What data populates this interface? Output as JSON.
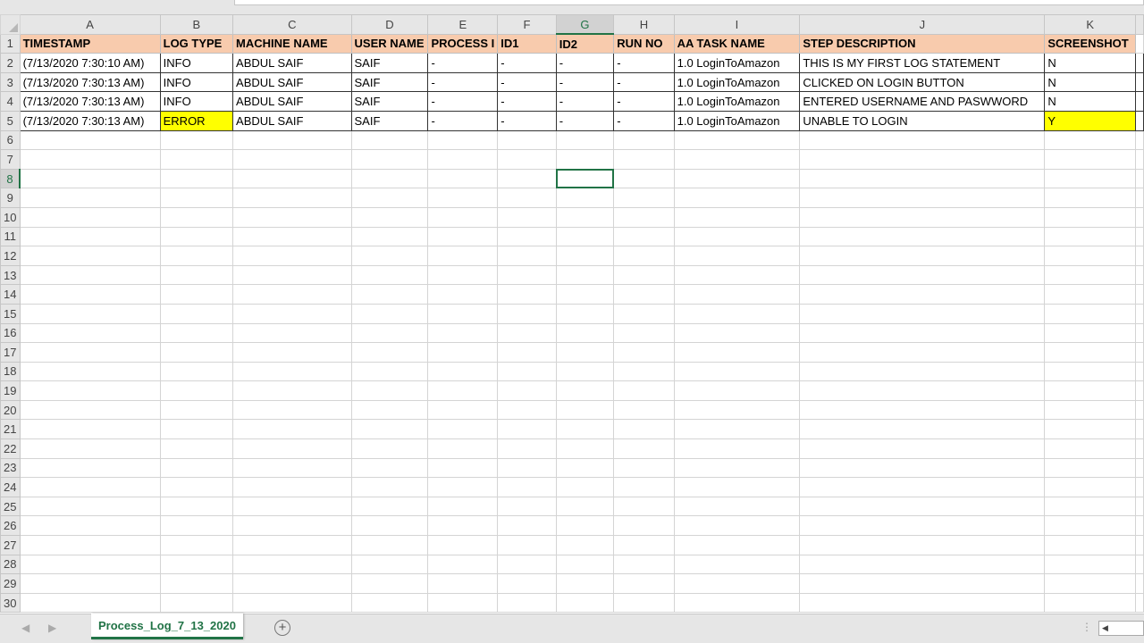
{
  "columns": [
    "A",
    "B",
    "C",
    "D",
    "E",
    "F",
    "G",
    "H",
    "I",
    "J",
    "K"
  ],
  "selected_column": "G",
  "selected_row": 8,
  "headers": [
    "TIMESTAMP",
    "LOG TYPE",
    "MACHINE NAME",
    "USER NAME",
    "PROCESS I",
    "ID1",
    "ID2",
    "RUN NO",
    "AA TASK NAME",
    "STEP DESCRIPTION",
    "SCREENSHOT"
  ],
  "rows": [
    [
      "(7/13/2020 7:30:10 AM)",
      "INFO",
      "ABDUL SAIF",
      "SAIF",
      "-",
      "-",
      "-",
      "-",
      "1.0 LoginToAmazon",
      "THIS IS MY FIRST LOG STATEMENT",
      "N"
    ],
    [
      "(7/13/2020 7:30:13 AM)",
      "INFO",
      "ABDUL SAIF",
      "SAIF",
      "-",
      "-",
      "-",
      "-",
      "1.0 LoginToAmazon",
      "CLICKED ON LOGIN BUTTON",
      "N"
    ],
    [
      "(7/13/2020 7:30:13 AM)",
      "INFO",
      "ABDUL SAIF",
      "SAIF",
      "-",
      "-",
      "-",
      "-",
      "1.0 LoginToAmazon",
      "ENTERED USERNAME AND PASWWORD",
      "N"
    ],
    [
      "(7/13/2020 7:30:13 AM)",
      "ERROR",
      "ABDUL SAIF",
      "SAIF",
      "-",
      "-",
      "-",
      "-",
      "1.0 LoginToAmazon",
      "UNABLE TO LOGIN",
      "Y"
    ]
  ],
  "row_count": 30,
  "highlight_color": "#ffff00",
  "header_fill": "#f8cbad",
  "sheet_tab": "Process_Log_7_13_2020",
  "add_sheet": "+",
  "nav_prev": "◀",
  "nav_next": "▶"
}
